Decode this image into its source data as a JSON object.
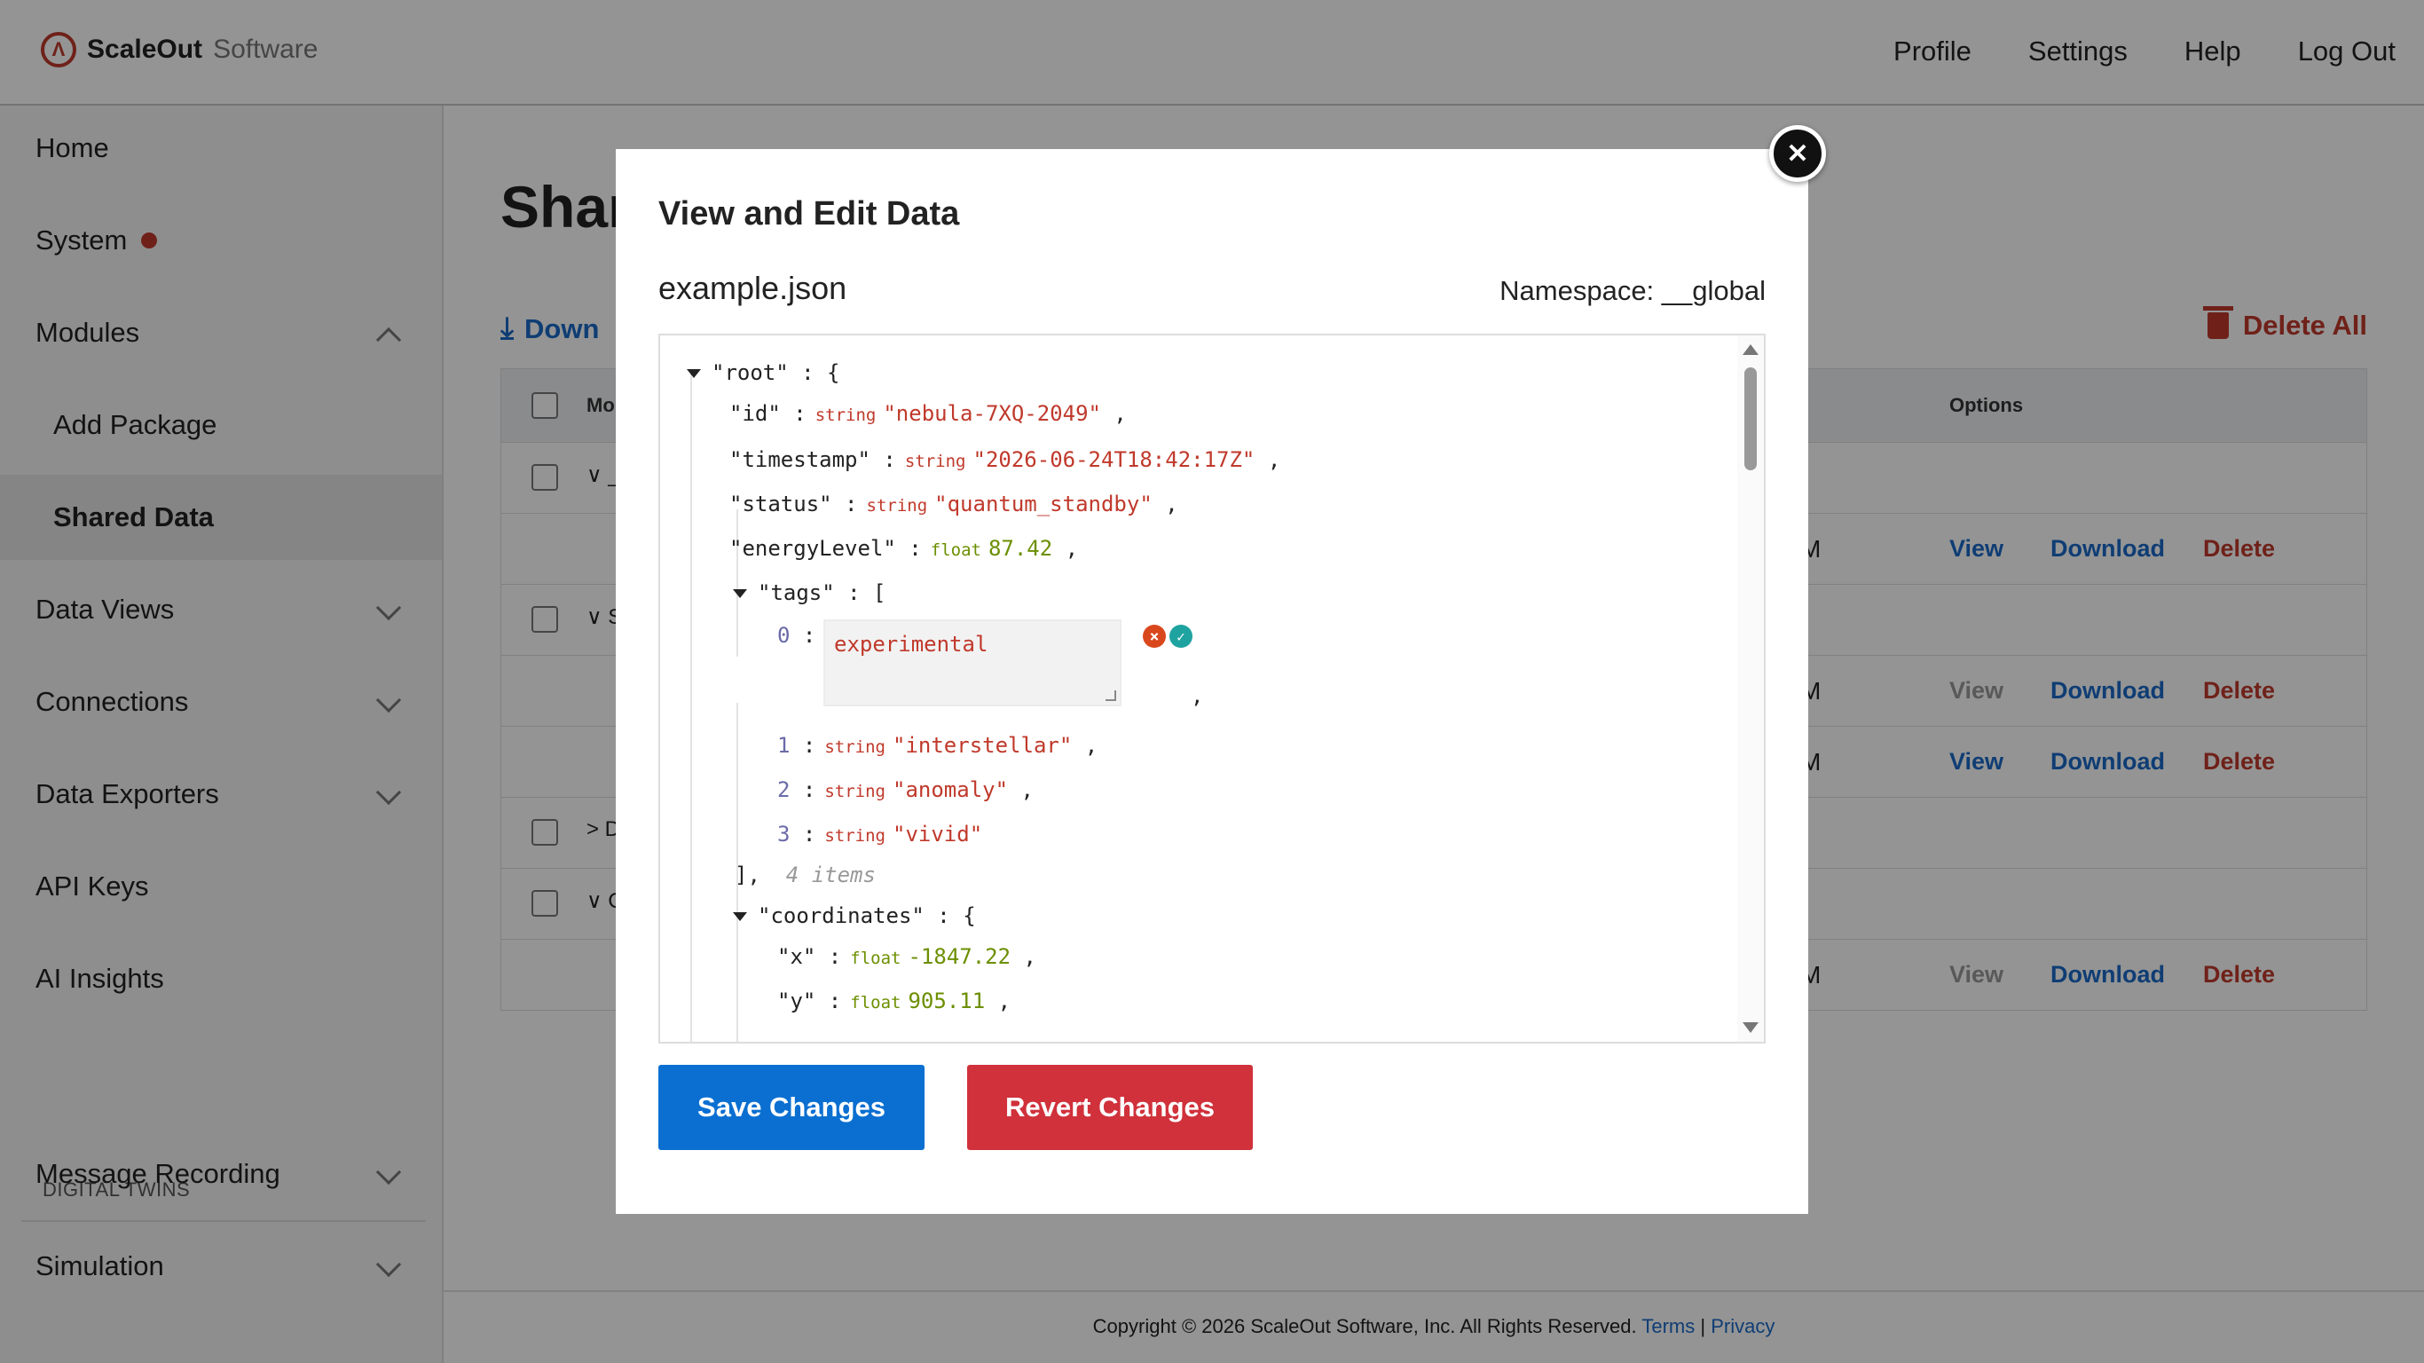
{
  "header": {
    "brand_bold": "ScaleOut",
    "brand_light": "Software",
    "nav": [
      "Profile",
      "Settings",
      "Help",
      "Log Out"
    ]
  },
  "sidebar": {
    "items": [
      {
        "label": "Home"
      },
      {
        "label": "System"
      },
      {
        "label": "Modules"
      },
      {
        "label": "Add Package"
      },
      {
        "label": "Shared Data"
      },
      {
        "label": "Data Views"
      },
      {
        "label": "Connections"
      },
      {
        "label": "Data Exporters"
      },
      {
        "label": "API Keys"
      },
      {
        "label": "AI Insights"
      }
    ],
    "section_title": "DIGITAL TWINS",
    "twin_items": [
      {
        "label": "Message Recording"
      },
      {
        "label": "Simulation"
      }
    ]
  },
  "main": {
    "title": "Shar",
    "download_label": "Down",
    "delete_all_label": "Delete All",
    "table": {
      "col_module": "Mo",
      "col_options": "Options",
      "rows": [
        {
          "caret": "∨ _",
          "time": "",
          "view": "",
          "download": "",
          "delete": ""
        },
        {
          "caret": "",
          "time": "M",
          "view": "View",
          "download": "Download",
          "delete": "Delete"
        },
        {
          "caret": "∨ S",
          "time": "",
          "view": "",
          "download": "",
          "delete": ""
        },
        {
          "caret": "",
          "time": "M",
          "view": "View",
          "download": "Download",
          "delete": "Delete"
        },
        {
          "caret": "",
          "time": "M",
          "view": "View",
          "download": "Download",
          "delete": "Delete"
        },
        {
          "caret": "> D",
          "time": "",
          "view": "",
          "download": "",
          "delete": ""
        },
        {
          "caret": "∨ C",
          "time": "",
          "view": "",
          "download": "",
          "delete": ""
        },
        {
          "caret": "",
          "time": "M",
          "view": "View",
          "download": "Download",
          "delete": "Delete"
        }
      ]
    },
    "footer": {
      "copyright": "Copyright © 2026 ScaleOut Software, Inc. All Rights Reserved.",
      "terms": "Terms",
      "sep": "|",
      "privacy": "Privacy"
    }
  },
  "modal": {
    "title": "View and Edit Data",
    "filename": "example.json",
    "namespace_label": "Namespace: __global",
    "json": {
      "root_key": "\"root\"",
      "id_key": "\"id\"",
      "id_type": "string",
      "id_val": "\"nebula-7XQ-2049\"",
      "ts_key": "\"timestamp\"",
      "ts_type": "string",
      "ts_val": "\"2026-06-24T18:42:17Z\"",
      "status_key": "\"status\"",
      "status_type": "string",
      "status_val": "\"quantum_standby\"",
      "energy_key": "\"energyLevel\"",
      "energy_type": "float",
      "energy_val": "87.42",
      "tags_key": "\"tags\"",
      "tag0_idx": "0",
      "tag0_edit": "experimental",
      "tag1_idx": "1",
      "tag1_type": "string",
      "tag1_val": "\"interstellar\"",
      "tag2_idx": "2",
      "tag2_type": "string",
      "tag2_val": "\"anomaly\"",
      "tag3_idx": "3",
      "tag3_type": "string",
      "tag3_val": "\"vivid\"",
      "tags_count": "4 items",
      "coords_key": "\"coordinates\"",
      "x_key": "\"x\"",
      "x_type": "float",
      "x_val": "-1847.22",
      "y_key": "\"y\"",
      "y_type": "float",
      "y_val": "905.11"
    },
    "save_label": "Save Changes",
    "revert_label": "Revert Changes"
  }
}
